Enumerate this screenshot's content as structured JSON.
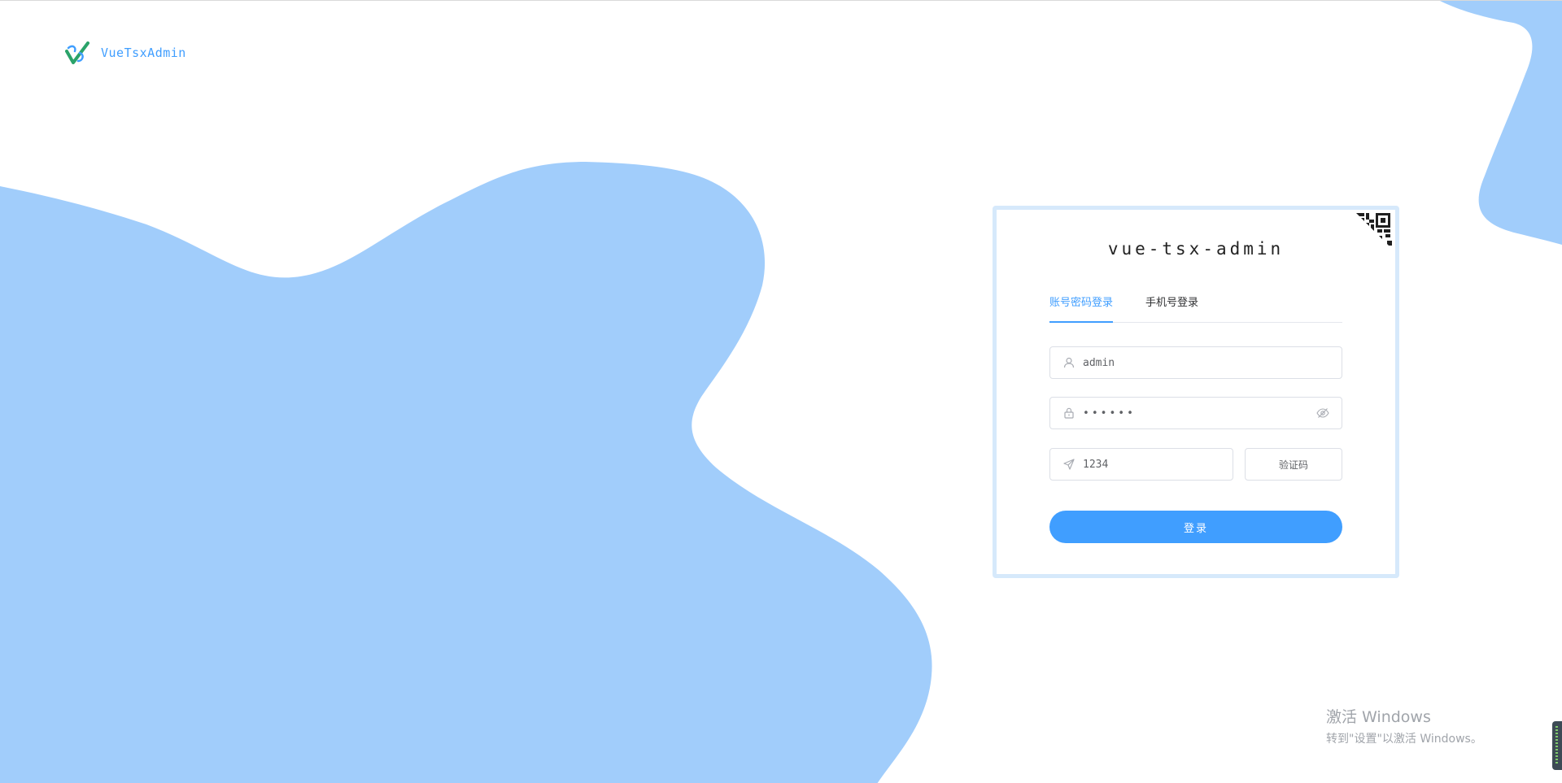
{
  "app": {
    "name": "VueTsxAdmin"
  },
  "login": {
    "title": "vue-tsx-admin",
    "tabs": [
      {
        "label": "账号密码登录",
        "active": true
      },
      {
        "label": "手机号登录",
        "active": false
      }
    ],
    "username": {
      "value": "admin",
      "icon": "user-icon"
    },
    "password": {
      "value": "••••••",
      "icon": "lock-icon",
      "toggle_icon": "eye-off-icon"
    },
    "captcha": {
      "value": "1234",
      "icon": "send-icon",
      "button_label": "验证码"
    },
    "submit_label": "登录",
    "qr_icon": "qr-code-icon"
  },
  "watermark": {
    "title": "激活 Windows",
    "subtitle": "转到\"设置\"以激活 Windows。"
  },
  "colors": {
    "primary": "#409eff",
    "blob": "#a1cdfb",
    "card_border": "#d6e9fb"
  }
}
